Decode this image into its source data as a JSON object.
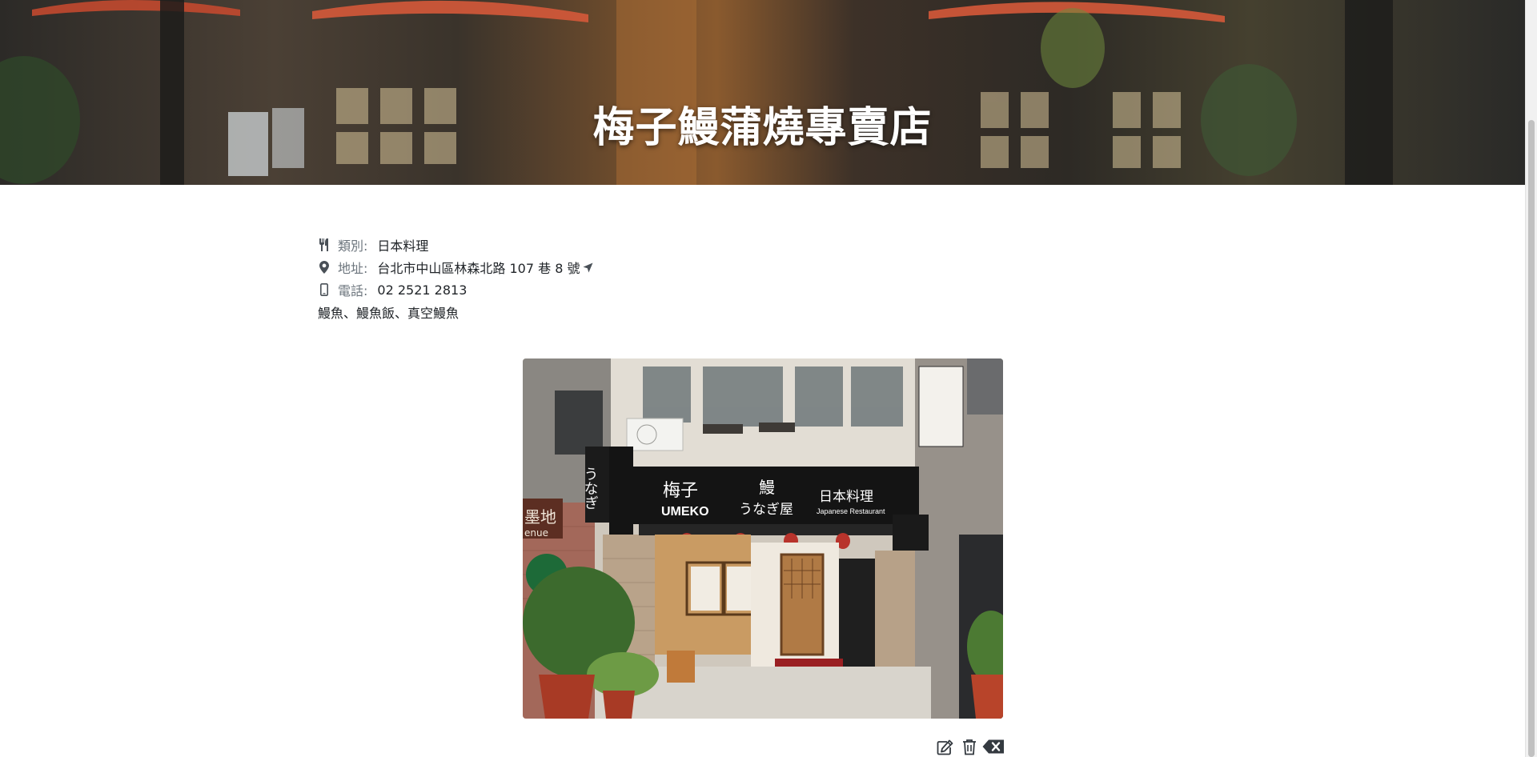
{
  "restaurant": {
    "name": "梅子鰻蒲燒專賣店",
    "category_label": "類別:",
    "category": "日本料理",
    "address_label": "地址:",
    "address": "台北市中山區林森北路 107 巷 8 號",
    "phone_label": "電話:",
    "phone": "02 2521 2813",
    "description": "鰻魚、鰻魚飯、真空鰻魚"
  },
  "photo_signage": {
    "brand_zh": "梅子",
    "brand_en": "UMEKO",
    "sign_eel": "鰻",
    "sign_unagiya": "うなぎ屋",
    "sign_cuisine": "日本料理",
    "sign_cuisine_en": "Japanese Restaurant",
    "hanging_sign": "うなぎ",
    "side_sign": "墨地",
    "side_sign_en": "enue"
  },
  "icons": {
    "category": "utensils-icon",
    "address": "map-marker-icon",
    "phone": "mobile-phone-icon",
    "navigate": "location-arrow-icon",
    "edit": "edit-icon",
    "delete": "trash-icon",
    "remove": "backspace-icon"
  },
  "colors": {
    "text": "#212529",
    "muted_label": "#6c757d",
    "icon": "#495057",
    "title_text": "#ffffff"
  }
}
